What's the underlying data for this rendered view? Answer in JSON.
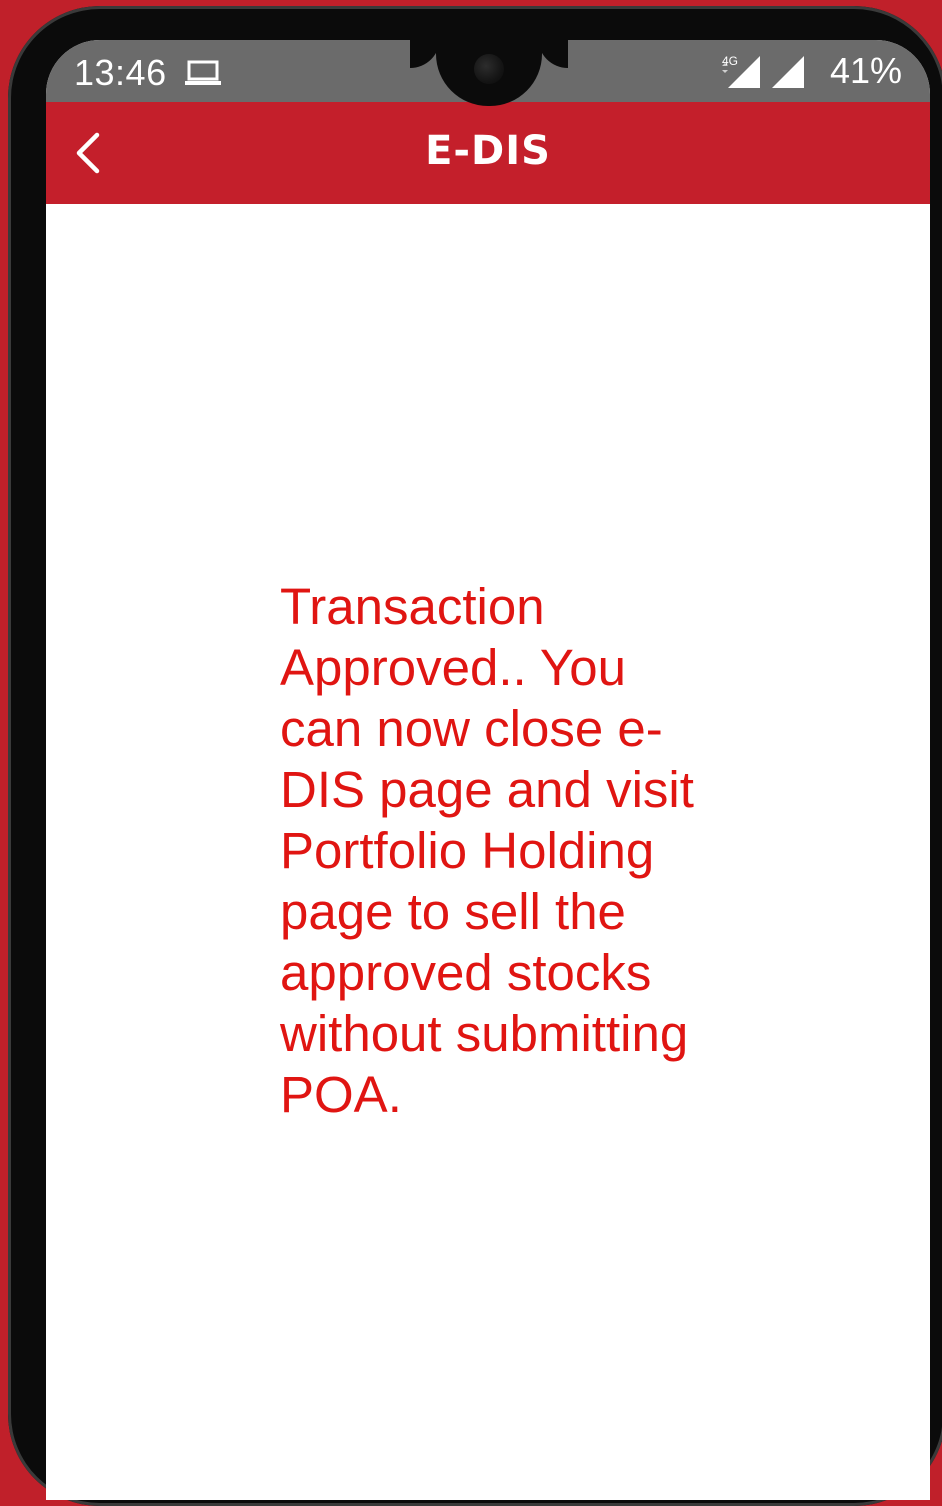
{
  "status_bar": {
    "time": "13:46",
    "network_type": "4G",
    "battery": "41%",
    "icons": [
      "laptop-icon",
      "signal-4g-icon",
      "signal-icon"
    ]
  },
  "header": {
    "title": "E-DIS",
    "back_icon": "chevron-left-icon",
    "background": "#c41f2b"
  },
  "content": {
    "message": "Transaction Approved.. You can now close e-DIS page and visit Portfolio Holding page to sell the approved stocks without submitting POA.",
    "message_color": "#e01512"
  }
}
